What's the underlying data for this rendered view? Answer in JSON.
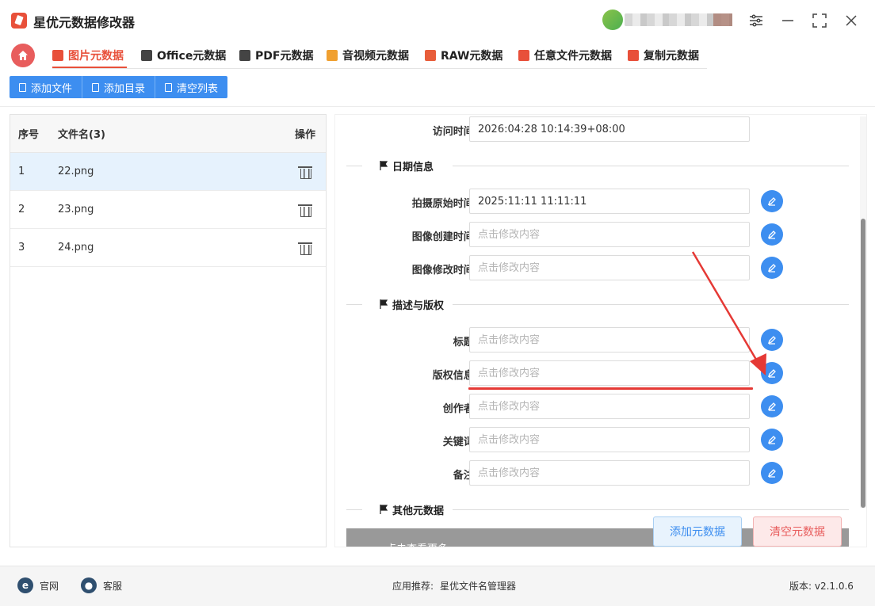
{
  "app": {
    "title": "星优元数据修改器"
  },
  "tabs": [
    {
      "label": "图片元数据",
      "color": "#e8503a"
    },
    {
      "label": "Office元数据",
      "color": "#444444"
    },
    {
      "label": "PDF元数据",
      "color": "#444444"
    },
    {
      "label": "音视频元数据",
      "color": "#f0a030"
    },
    {
      "label": "RAW元数据",
      "color": "#e85d3a"
    },
    {
      "label": "任意文件元数据",
      "color": "#e8503a"
    },
    {
      "label": "复制元数据",
      "color": "#e8503a"
    }
  ],
  "toolbar": {
    "add_file": "添加文件",
    "add_dir": "添加目录",
    "clear_list": "清空列表"
  },
  "filelist": {
    "col_index": "序号",
    "col_name": "文件名(3)",
    "col_op": "操作",
    "rows": [
      {
        "index": "1",
        "name": "22.png"
      },
      {
        "index": "2",
        "name": "23.png"
      },
      {
        "index": "3",
        "name": "24.png"
      }
    ]
  },
  "form": {
    "access_time": {
      "label": "访问时间:",
      "value": "2026:04:28 10:14:39+08:00"
    },
    "section_date": "日期信息",
    "shot_time": {
      "label": "拍摄原始时间:",
      "value": "2025:11:11 11:11:11"
    },
    "create_time": {
      "label": "图像创建时间:",
      "placeholder": "点击修改内容"
    },
    "modify_time": {
      "label": "图像修改时间:",
      "placeholder": "点击修改内容"
    },
    "section_desc": "描述与版权",
    "title": {
      "label": "标题:",
      "placeholder": "点击修改内容"
    },
    "copyright": {
      "label": "版权信息:",
      "placeholder": "点击修改内容"
    },
    "creator": {
      "label": "创作者:",
      "placeholder": "点击修改内容"
    },
    "keywords": {
      "label": "关键词:",
      "placeholder": "点击修改内容"
    },
    "remark": {
      "label": "备注:",
      "placeholder": "点击修改内容"
    },
    "section_other": "其他元数据",
    "gray_bar_text": "点击查看更多"
  },
  "actions": {
    "add_meta": "添加元数据",
    "clear_meta": "清空元数据"
  },
  "footer": {
    "website": "官网",
    "support": "客服",
    "recommend_label": "应用推荐:",
    "recommend_app": "星优文件名管理器",
    "version": "版本: v2.1.0.6"
  }
}
